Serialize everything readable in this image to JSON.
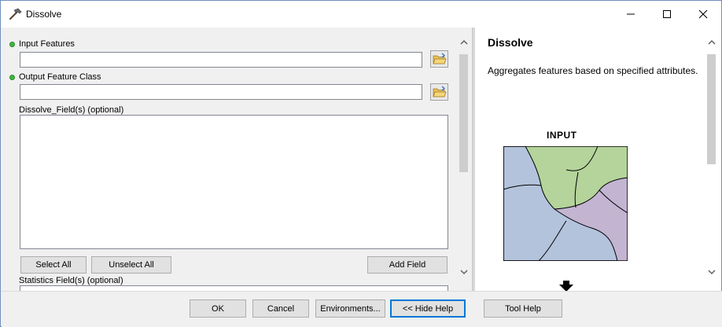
{
  "window": {
    "title": "Dissolve",
    "icon": "hammer-icon",
    "controls": [
      "minimize-icon",
      "maximize-icon",
      "close-icon"
    ]
  },
  "form": {
    "input_features": {
      "label": "Input Features",
      "value": "",
      "required": true
    },
    "output_feature_class": {
      "label": "Output Feature Class",
      "value": "",
      "required": true
    },
    "dissolve_fields": {
      "label": "Dissolve_Field(s) (optional)",
      "items": []
    },
    "select_all_label": "Select All",
    "unselect_all_label": "Unselect All",
    "add_field_label": "Add Field",
    "statistics_fields": {
      "label": "Statistics Field(s) (optional)"
    }
  },
  "help": {
    "title": "Dissolve",
    "description": "Aggregates features based on specified attributes.",
    "diagram_label": "INPUT",
    "colors": {
      "green": "#b4d49b",
      "purple": "#c3b4d2",
      "blue": "#b4c3dc"
    }
  },
  "buttons": {
    "ok": "OK",
    "cancel": "Cancel",
    "environments": "Environments...",
    "hide_help": "<< Hide Help",
    "tool_help": "Tool Help"
  },
  "colors": {
    "required_dot": "#3fb73f",
    "default_button_border": "#0078d7"
  }
}
